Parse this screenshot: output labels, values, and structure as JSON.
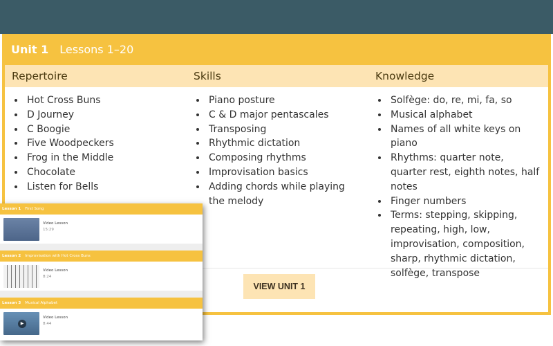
{
  "unit": {
    "title": "Unit 1",
    "subtitle": "Lessons 1–20"
  },
  "columns": [
    {
      "heading": "Repertoire",
      "items": [
        "Hot Cross Buns",
        "D Journey",
        "C Boogie",
        "Five Woodpeckers",
        "Frog in the Middle",
        "Chocolate",
        "Listen for Bells"
      ]
    },
    {
      "heading": "Skills",
      "items": [
        "Piano posture",
        "C & D major pentascales",
        "Transposing",
        "Rhythmic dictation",
        "Composing rhythms",
        "Improvisation basics",
        "Adding chords while playing the melody"
      ]
    },
    {
      "heading": "Knowledge",
      "items": [
        "Solfège: do, re, mi, fa, so",
        "Musical alphabet",
        "Names of all white keys on piano",
        "Rhythms: quarter note, quarter rest, eighth notes, half notes",
        "Finger numbers",
        "Terms: stepping, skipping, repeating, high, low, improvisation, composition, sharp, rhythmic dictation, solfège, transpose"
      ]
    }
  ],
  "view_button": "VIEW UNIT 1",
  "lessons": [
    {
      "num": "Lesson 1",
      "title": "First Song",
      "type": "Video Lesson",
      "duration": "15:29",
      "thumb_icon": "teacher-video-thumbnail"
    },
    {
      "num": "Lesson 2",
      "title": "Improvisation with Hot Cross Buns",
      "type": "Video Lesson",
      "duration": "8:24",
      "thumb_icon": "piano-keys-thumbnail"
    },
    {
      "num": "Lesson 3",
      "title": "Musical Alphabet",
      "type": "Video Lesson",
      "duration": "8:44",
      "thumb_icon": "play-video-thumbnail"
    }
  ],
  "colors": {
    "top_band": "#3b5b66",
    "accent": "#f6c240",
    "light_accent": "#fde4b4"
  }
}
